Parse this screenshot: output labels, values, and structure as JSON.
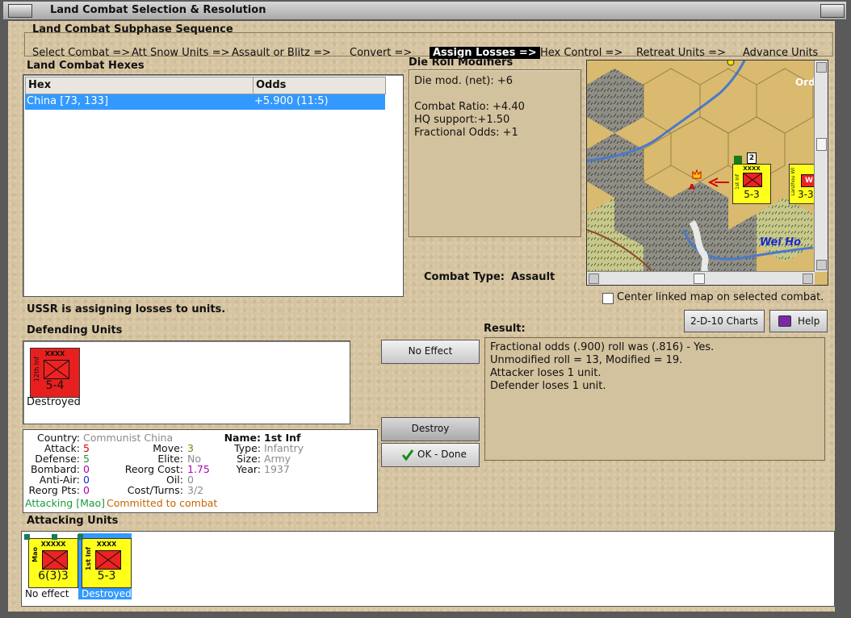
{
  "window": {
    "title": "Land Combat Selection & Resolution"
  },
  "subphase": {
    "title": "Land Combat Subphase Sequence",
    "steps": [
      "Select Combat =>",
      "Att Snow Units =>",
      "Assault or Blitz =>",
      "Convert =>",
      "Assign Losses =>",
      "Hex Control =>",
      "Retreat Units =>",
      "Advance Units"
    ]
  },
  "hexes": {
    "title": "Land Combat Hexes",
    "columns": [
      "Hex",
      "Odds"
    ],
    "rows": [
      {
        "hex": "China [73, 133]",
        "odds": "+5.900 (11:5)"
      }
    ]
  },
  "drm": {
    "title": "Die Roll Modifiers",
    "lines": [
      "Die mod. (net): +6",
      "",
      "Combat Ratio: +4.40",
      "HQ support:+1.50",
      "Fractional Odds: +1"
    ]
  },
  "combat_type": {
    "label": "Combat Type:",
    "value": "Assault"
  },
  "map": {
    "labels": [
      "Ord",
      "Wei Ho"
    ],
    "hex_marker": "A",
    "stack_count": "2"
  },
  "center_linked": {
    "label": "Center linked map on selected combat."
  },
  "status": "USSR is assigning losses to units.",
  "defending": {
    "title": "Defending Units",
    "units": [
      {
        "size": "XXXX",
        "name": "12th Inf",
        "strength": "5-4",
        "status": "Destroyed",
        "color": "#e81f1f"
      }
    ]
  },
  "buttons": {
    "charts": "2-D-10 Charts",
    "help": "Help",
    "no_effect": "No Effect",
    "destroy": "Destroy",
    "ok": "OK - Done"
  },
  "result": {
    "title": "Result:",
    "lines": [
      "Fractional odds (.900) roll was (.816)  - Yes.",
      "Unmodified roll = 13, Modified = 19.",
      "Attacker loses 1 unit.",
      "Defender loses 1 unit."
    ]
  },
  "unit_details": {
    "country_label": "Country:",
    "country": "Communist China",
    "attack_label": "Attack:",
    "attack": "5",
    "defense_label": "Defense:",
    "defense": "5",
    "bombard_label": "Bombard:",
    "bombard": "0",
    "antiair_label": "Anti-Air:",
    "antiair": "0",
    "reorg_pts_label": "Reorg Pts:",
    "reorg_pts": "0",
    "move_label": "Move:",
    "move": "3",
    "elite_label": "Elite:",
    "elite": "No",
    "reorg_cost_label": "Reorg Cost:",
    "reorg_cost": "1.75",
    "oil_label": "Oil:",
    "oil": "0",
    "cost_turns_label": "Cost/Turns:",
    "cost_turns": "3/2",
    "name_label": "Name:",
    "name": "1st Inf",
    "type_label": "Type:",
    "type": "Infantry",
    "size_label": "Size:",
    "size": "Army",
    "year_label": "Year:",
    "year": "1937",
    "attacking": "Attacking [Mao]",
    "committed": "Committed to combat"
  },
  "attacking": {
    "title": "Attacking Units",
    "units": [
      {
        "size": "XXXXX",
        "name": "Mao",
        "strength": "6(3)3",
        "status": "No effect",
        "color": "#ffff1a"
      },
      {
        "size": "XXXX",
        "name": "1st Inf",
        "strength": "5-3",
        "status": "Destroyed",
        "color": "#ffff1a"
      }
    ]
  },
  "map_units": [
    {
      "size": "XXXX",
      "name": "1st Inf",
      "strength": "5-3"
    },
    {
      "size": "",
      "name": "Lanzhou Wl",
      "strength": "3-3"
    }
  ],
  "colors": {
    "accent": "#3399ff",
    "panel": "#d6c4a0",
    "attacking_green": "#1a9a3a",
    "committed_orange": "#c86400"
  }
}
